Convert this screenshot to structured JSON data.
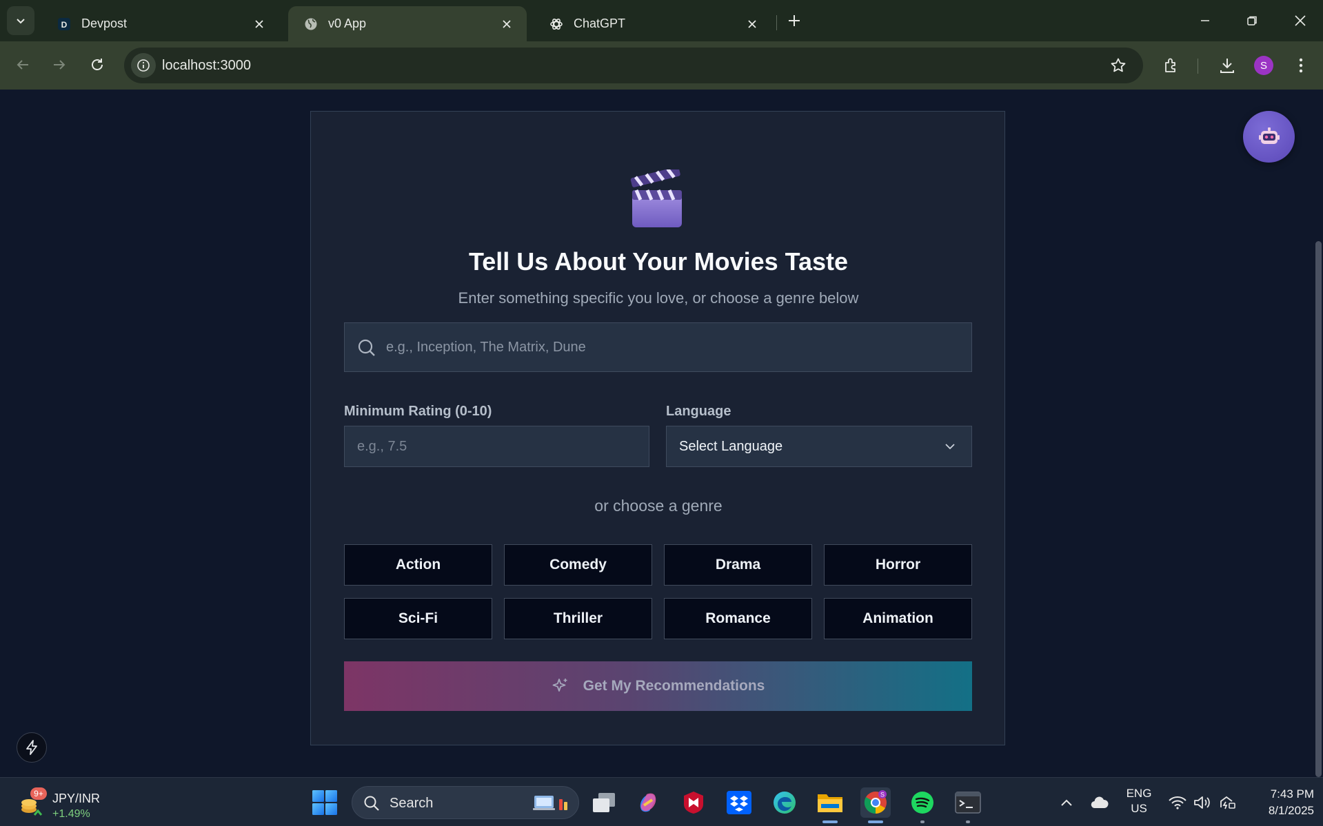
{
  "browser": {
    "tabs": [
      {
        "title": "Devpost",
        "favicon": "devpost-icon"
      },
      {
        "title": "v0 App",
        "favicon": "globe-icon",
        "active": true
      },
      {
        "title": "ChatGPT",
        "favicon": "chatgpt-icon"
      }
    ],
    "url": "localhost:3000",
    "profile_initial": "S"
  },
  "form": {
    "title": "Tell Us About Your Movies Taste",
    "subtitle": "Enter something specific you love, or choose a genre below",
    "search_placeholder": "e.g., Inception, The Matrix, Dune",
    "rating_label": "Minimum Rating (0-10)",
    "rating_placeholder": "e.g., 7.5",
    "language_label": "Language",
    "language_value": "Select Language",
    "genre_prompt": "or choose a genre",
    "genres": [
      "Action",
      "Comedy",
      "Drama",
      "Horror",
      "Sci-Fi",
      "Thriller",
      "Romance",
      "Animation"
    ],
    "cta_label": "Get My Recommendations"
  },
  "taskbar": {
    "widget": {
      "badge": "9+",
      "name": "JPY/INR",
      "change": "+1.49%"
    },
    "search_label": "Search",
    "lang": {
      "line1": "ENG",
      "line2": "US"
    },
    "time": "7:43 PM",
    "date": "8/1/2025"
  },
  "colors": {
    "page_bg": "#0f172a",
    "card_bg": "#1a2233",
    "cta_gradient_start": "#7d3566",
    "cta_gradient_end": "#137086",
    "bot_button": "#6a58c8",
    "chrome_tab_bg": "#1e2a1f"
  }
}
